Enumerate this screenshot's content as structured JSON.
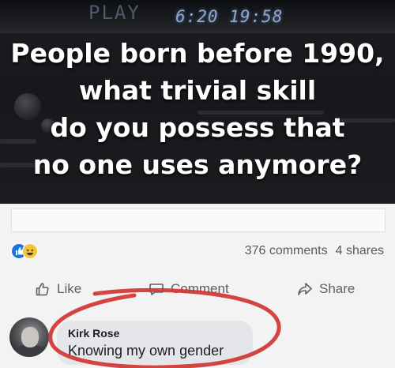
{
  "hero": {
    "vcr_mode": "PLAY",
    "vcr_time": "6:20 19:58",
    "title_lines": [
      "People born before 1990,",
      "what trivial skill",
      "do you possess that",
      "no one uses anymore?"
    ]
  },
  "post": {
    "comments_count": "376 comments",
    "shares_count": "4 shares",
    "reaction_icons": [
      "like-reaction-icon",
      "haha-reaction-icon"
    ]
  },
  "actions": {
    "like_label": "Like",
    "comment_label": "Comment",
    "share_label": "Share"
  },
  "comment": {
    "author": "Kirk Rose",
    "text": "Knowing my own gender"
  },
  "colors": {
    "accent_blue": "#1b74e4",
    "haha_yellow": "#f5c33b",
    "annotation_red": "#d0312d"
  }
}
